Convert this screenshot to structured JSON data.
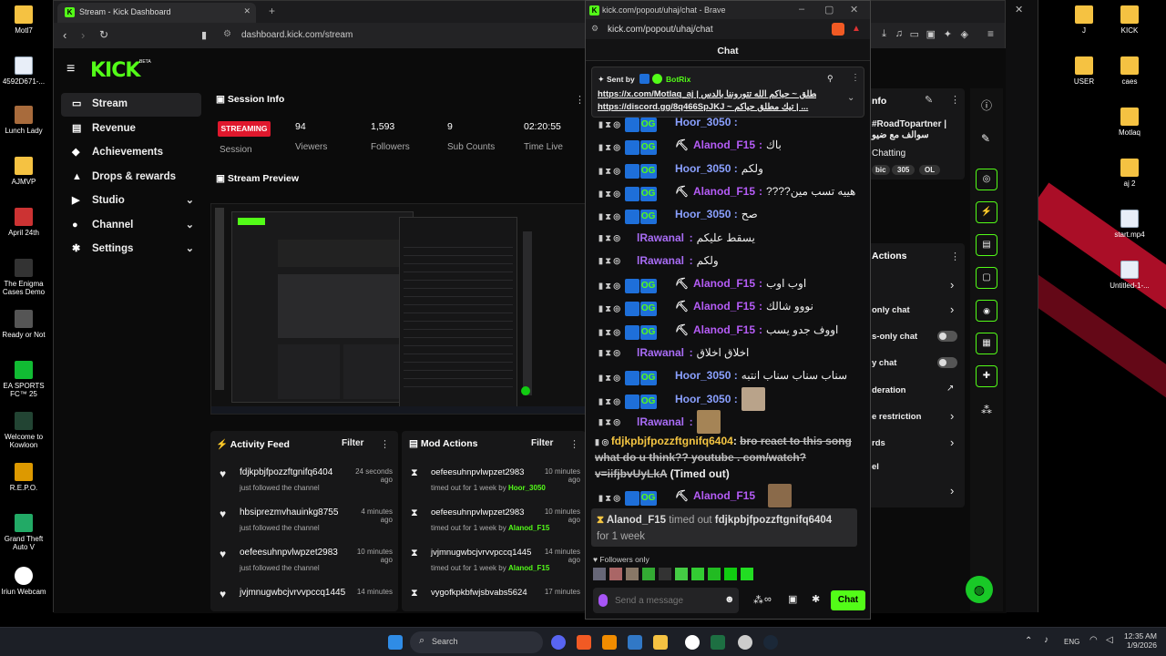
{
  "desktop": {
    "left_icons": [
      "Motl7",
      "4592D671-...",
      "Lunch Lady",
      "AJMVP",
      "April 24th",
      "The Enigma Cases Demo",
      "Ready or Not",
      "EA SPORTS FC™ 25",
      "Welcome to Kowloon",
      "R.E.P.O.",
      "Grand Theft Auto V",
      "Iriun Webcam"
    ],
    "right_icons_col1": [
      "J",
      "USER",
      "Motlaq",
      "aj 2",
      "start.mp4",
      "Untitled-1-..."
    ],
    "right_icons_col2": [
      "KICK",
      "caes"
    ]
  },
  "browser": {
    "tab_title": "Stream - Kick Dashboard",
    "url": "dashboard.kick.com/stream"
  },
  "dashboard": {
    "logo": "KICK",
    "logo_beta": "BETA",
    "nav": [
      "Stream",
      "Revenue",
      "Achievements",
      "Drops & rewards",
      "Studio",
      "Channel",
      "Settings"
    ],
    "session_info": {
      "title": "Session Info",
      "status": "STREAMING",
      "status_label": "Session",
      "stats": [
        {
          "value": "94",
          "label": "Viewers"
        },
        {
          "value": "1,593",
          "label": "Followers"
        },
        {
          "value": "9",
          "label": "Sub Counts"
        },
        {
          "value": "02:20:55",
          "label": "Time Live"
        }
      ]
    },
    "stream_preview_title": "Stream Preview",
    "activity_feed": {
      "title": "Activity Feed",
      "filter": "Filter",
      "items": [
        {
          "name": "fdjkpbjfpozzftgnifq6404",
          "sub": "just followed the channel",
          "time": "24 seconds ago"
        },
        {
          "name": "hbsiprezmvhauinkg8755",
          "sub": "just followed the channel",
          "time": "4 minutes ago"
        },
        {
          "name": "oefeesuhnpvlwpzet2983",
          "sub": "just followed the channel",
          "time": "10 minutes ago"
        },
        {
          "name": "jvjmnugwbcjvrvvpccq1445",
          "sub": "",
          "time": "14 minutes"
        }
      ]
    },
    "mod_actions": {
      "title": "Mod Actions",
      "filter": "Filter",
      "items": [
        {
          "name": "oefeesuhnpvlwpzet2983",
          "prefix": "timed out for 1 week by ",
          "by": "Hoor_3050",
          "time": "10 minutes ago"
        },
        {
          "name": "oefeesuhnpvlwpzet2983",
          "prefix": "timed out for 1 week by ",
          "by": "Alanod_F15",
          "time": "10 minutes ago"
        },
        {
          "name": "jvjmnugwbcjvrvvpccq1445",
          "prefix": "timed out for 1 week by ",
          "by": "Alanod_F15",
          "time": "14 minutes ago"
        },
        {
          "name": "vygofkpkbfwjsbvabs5624",
          "prefix": "",
          "by": "",
          "time": "17 minutes"
        }
      ]
    },
    "right_panel": {
      "stream_info_title": "nfo",
      "title_text": "#RoadTopartner | سوالف مع ضيو",
      "category": "Chatting",
      "tags": [
        "bic",
        "305",
        "OL"
      ],
      "chat_actions_title": "Actions",
      "actions": [
        "only chat",
        "s-only chat",
        "y chat",
        "deration",
        "e restriction",
        "rds",
        "el"
      ]
    }
  },
  "chat": {
    "window_url": "kick.com/popout/uhaj/chat - Brave",
    "addr_url": "kick.com/popout/uhaj/chat",
    "header": "Chat",
    "pinned": {
      "sent_by_label": "Sent by",
      "sender": "BotRix",
      "line1": "https://x.com/Motlaq_aj | تويتر مطلق ~ حياكم الله تتوروننا بالدس |",
      "line2": "https://discord.gg/8q466SpJKJ ~ تيك مطلق حياكم | ..."
    },
    "messages": [
      {
        "user": "Hoor_3050",
        "text": "",
        "color": "#8aa0ff"
      },
      {
        "user": "Alanod_F15",
        "text": "باك",
        "color": "#b55cf6"
      },
      {
        "user": "Hoor_3050",
        "text": "ولكم",
        "color": "#8aa0ff"
      },
      {
        "user": "Alanod_F15",
        "text": "????هييه تسب مين",
        "color": "#b55cf6"
      },
      {
        "user": "Hoor_3050",
        "text": "صح",
        "color": "#8aa0ff"
      },
      {
        "user": "lRawanal",
        "text": "يسقط عليكم",
        "color": "#a86cf5"
      },
      {
        "user": "lRawanal",
        "text": "ولكم",
        "color": "#a86cf5"
      },
      {
        "user": "Alanod_F15",
        "text": "اوب اوب",
        "color": "#b55cf6"
      },
      {
        "user": "Alanod_F15",
        "text": "نووو شالك",
        "color": "#b55cf6"
      },
      {
        "user": "Alanod_F15",
        "text": "اووف جدو يسب",
        "color": "#b55cf6"
      },
      {
        "user": "lRawanal",
        "text": "اخلاق اخلاق",
        "color": "#a86cf5"
      },
      {
        "user": "Hoor_3050",
        "text": "سناب سناب سناب انتبه",
        "color": "#8aa0ff"
      },
      {
        "user": "Hoor_3050",
        "text": "",
        "color": "#8aa0ff"
      },
      {
        "user": "lRawanal",
        "text": "",
        "color": "#a86cf5"
      }
    ],
    "deleted_message": {
      "user": "fdjkpbjfpozzftgnifq6404",
      "text": "bro react to this song what do u think?? youtube . com/watch?v=iifjbvUyLkA",
      "note": "(Timed out)"
    },
    "last_message_user": "Alanod_F15",
    "system_notice": {
      "actor": "Alanod_F15",
      "action": "timed out",
      "target": "fdjkpbjfpozzftgnifq6404",
      "duration": "for 1 week"
    },
    "followers_only": "Followers only",
    "input_placeholder": "Send a message",
    "send_button": "Chat"
  },
  "taskbar": {
    "search": "Search",
    "lang": "ENG",
    "time": "12:35 AM",
    "date": "1/9/2026"
  }
}
